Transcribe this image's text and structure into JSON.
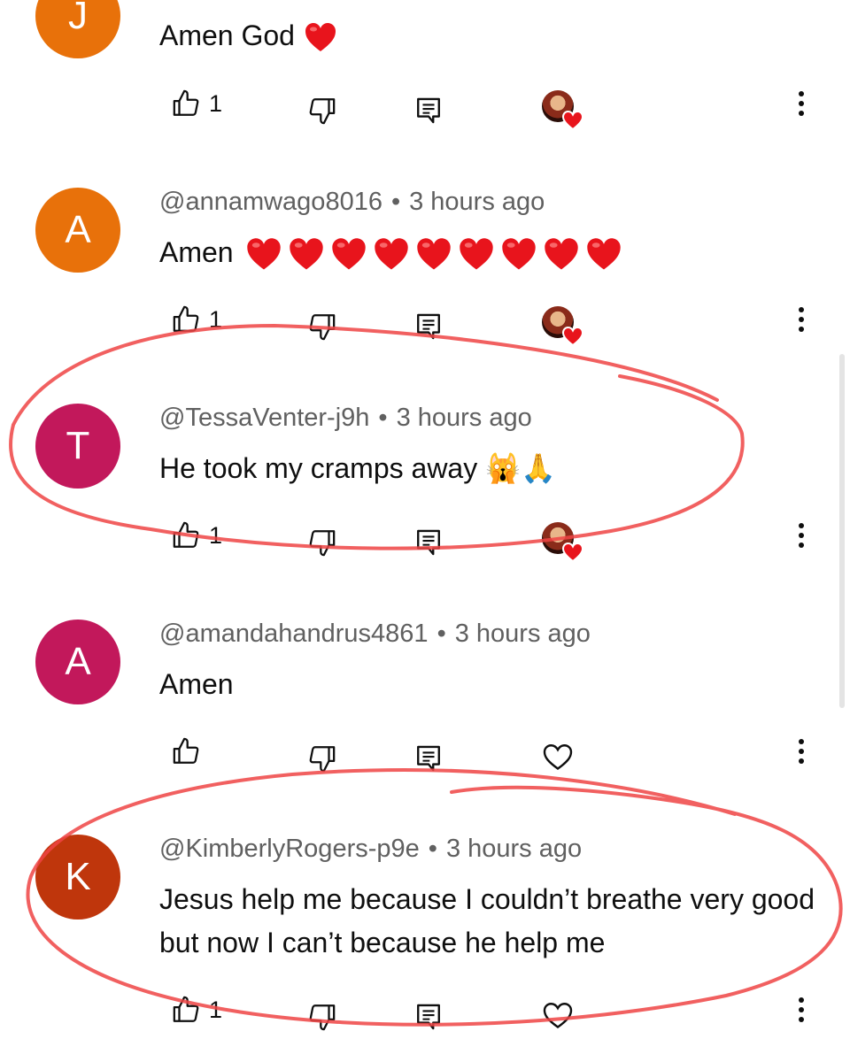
{
  "colors": {
    "avatar_orange": "#e8710a",
    "avatar_magenta": "#c2185b",
    "avatar_rust": "#bf360c",
    "meta_gray": "#606060",
    "annotation_red": "#ef4444"
  },
  "comments": [
    {
      "initial": "J",
      "avatar_color": "#e8710a",
      "author": "",
      "time": "",
      "text": "Amen God",
      "emoji_hearts": 1,
      "likes": "1",
      "creator_heart": true
    },
    {
      "initial": "A",
      "avatar_color": "#e8710a",
      "author": "@annamwago8016",
      "time": "3 hours ago",
      "text": "Amen",
      "emoji_hearts": 9,
      "likes": "1",
      "creator_heart": true
    },
    {
      "initial": "T",
      "avatar_color": "#c2185b",
      "author": "@TessaVenter-j9h",
      "time": "3 hours ago",
      "text": "He took my cramps away 🙀🙏",
      "likes": "1",
      "creator_heart": true
    },
    {
      "initial": "A",
      "avatar_color": "#c2185b",
      "author": "@amandahandrus4861",
      "time": "3 hours ago",
      "text": "Amen",
      "likes": "",
      "creator_heart": false
    },
    {
      "initial": "K",
      "avatar_color": "#bf360c",
      "author": "@KimberlyRogers-p9e",
      "time": "3 hours ago",
      "text": "Jesus help me because I couldn’t breathe very good but now I can’t because he help me",
      "likes": "1",
      "creator_heart": false
    }
  ],
  "separator": "•",
  "icons": [
    "thumbs-up-icon",
    "thumbs-down-icon",
    "reply-icon",
    "creator-heart-icon",
    "heart-outline-icon",
    "more-vert-icon"
  ]
}
